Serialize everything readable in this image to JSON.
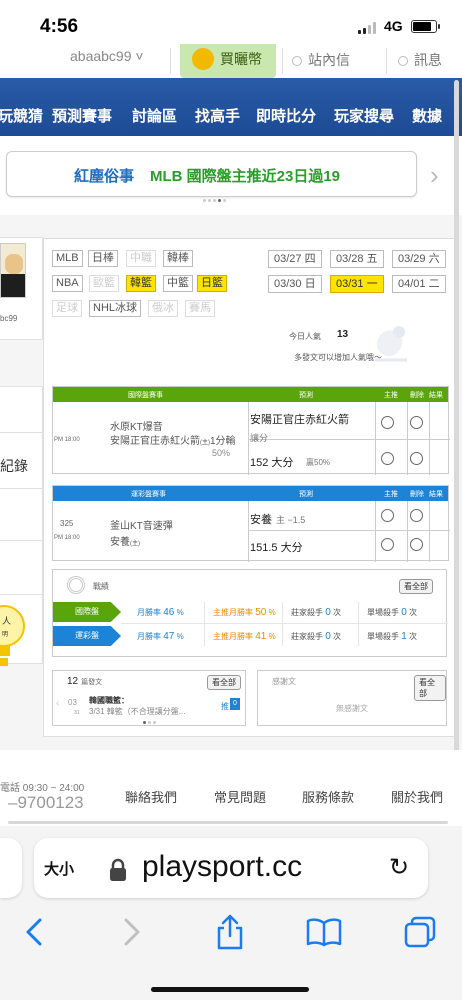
{
  "status": {
    "time": "4:56",
    "network": "4G"
  },
  "user_menu": {
    "username": "abaabc99",
    "store": "買曬幣",
    "messages": "站內信",
    "news": "訊息"
  },
  "nav": [
    "玩競猜",
    "預測賽事",
    "討論區",
    "找高手",
    "即時比分",
    "玩家搜尋",
    "數據"
  ],
  "banner": {
    "part1": "紅塵俗事",
    "part2": "MLB 國際盤主推近23日過19"
  },
  "profile": {
    "id": "bc99"
  },
  "left_panel": {
    "record": "紀錄",
    "partial_label": "人",
    "partial_sub": "明"
  },
  "leagues": [
    {
      "label": "MLB",
      "state": "normal"
    },
    {
      "label": "日棒",
      "state": "normal"
    },
    {
      "label": "中職",
      "state": "disabled"
    },
    {
      "label": "韓棒",
      "state": "normal"
    },
    {
      "label": "NBA",
      "state": "normal"
    },
    {
      "label": "歐籃",
      "state": "disabled"
    },
    {
      "label": "韓籃",
      "state": "active"
    },
    {
      "label": "中籃",
      "state": "normal"
    },
    {
      "label": "日籃",
      "state": "active"
    },
    {
      "label": "足球",
      "state": "disabled"
    },
    {
      "label": "NHL冰球",
      "state": "normal"
    },
    {
      "label": "俄冰",
      "state": "disabled"
    },
    {
      "label": "賽馬",
      "state": "disabled"
    }
  ],
  "dates": [
    {
      "label": "03/27 四",
      "active": false
    },
    {
      "label": "03/28 五",
      "active": false
    },
    {
      "label": "03/29 六",
      "active": false
    },
    {
      "label": "03/30 日",
      "active": false
    },
    {
      "label": "03/31 一",
      "active": true
    },
    {
      "label": "04/01 二",
      "active": false
    }
  ],
  "hits": {
    "label": "今日人氣",
    "value": "13",
    "note": "多發文可以增加人氣哦～"
  },
  "intl_table": {
    "headers": {
      "game": "國際盤賽事",
      "pred": "預測",
      "main": "主推",
      "del": "刪除",
      "result": "結果"
    },
    "game_time": "PM 18:00",
    "away_team": "水原KT爆音",
    "home_team": "安陽正官庄赤紅火箭",
    "home_sup": "(主)",
    "home_note": "1分輸",
    "home_pct": "50%",
    "pick1": "安陽正官庄赤紅火箭",
    "pick1_sub": "讓分",
    "pick2": "152 大分",
    "pick2_sub": "贏50%"
  },
  "lottery_table": {
    "headers": {
      "game": "運彩盤賽事",
      "pred": "預測",
      "main": "主推",
      "del": "刪除",
      "result": "結果"
    },
    "game_no": "325",
    "game_time": "PM 18:00",
    "away_team": "釜山KT音速彈",
    "home_team": "安養",
    "home_sup": "(主)",
    "pick1": "安養",
    "pick1_sub": "主 −1.5",
    "pick2": "151.5 大分"
  },
  "record": {
    "title": "戰績",
    "all_button": "看全部",
    "rows": [
      {
        "label": "國際盤",
        "color": "#5aa40c",
        "win_label": "月勝率",
        "win": "46",
        "main_label": "主推月勝率",
        "main": "50",
        "banker_label": "莊家殺手",
        "banker": "0",
        "single_label": "單場殺手",
        "single": "0",
        "unit": "次",
        "pct": "%"
      },
      {
        "label": "運彩盤",
        "color": "#1d83d6",
        "win_label": "月勝率",
        "win": "47",
        "main_label": "主推月勝率",
        "main": "41",
        "banker_label": "莊家殺手",
        "banker": "0",
        "single_label": "單場殺手",
        "single": "1",
        "unit": "次",
        "pct": "%"
      }
    ]
  },
  "posts": {
    "count": "12",
    "count_label": "篇發文",
    "all_button": "看全部",
    "date_top": "03",
    "date_bottom": "31",
    "item_title": "韓國職籃：",
    "item_desc": "3/31 韓籃（不合理讓分盤...",
    "push_label": "推",
    "push_count": "0"
  },
  "thanks": {
    "title": "感謝文",
    "all_button": "看全部",
    "empty": "無感謝文"
  },
  "footer": {
    "hours": "電話 09:30 ~ 24:00",
    "phone": "–9700123",
    "links": [
      "聯絡我們",
      "常見問題",
      "服務條款",
      "關於我們"
    ]
  },
  "browser": {
    "text_size": "大小",
    "url": "playsport.cc"
  }
}
